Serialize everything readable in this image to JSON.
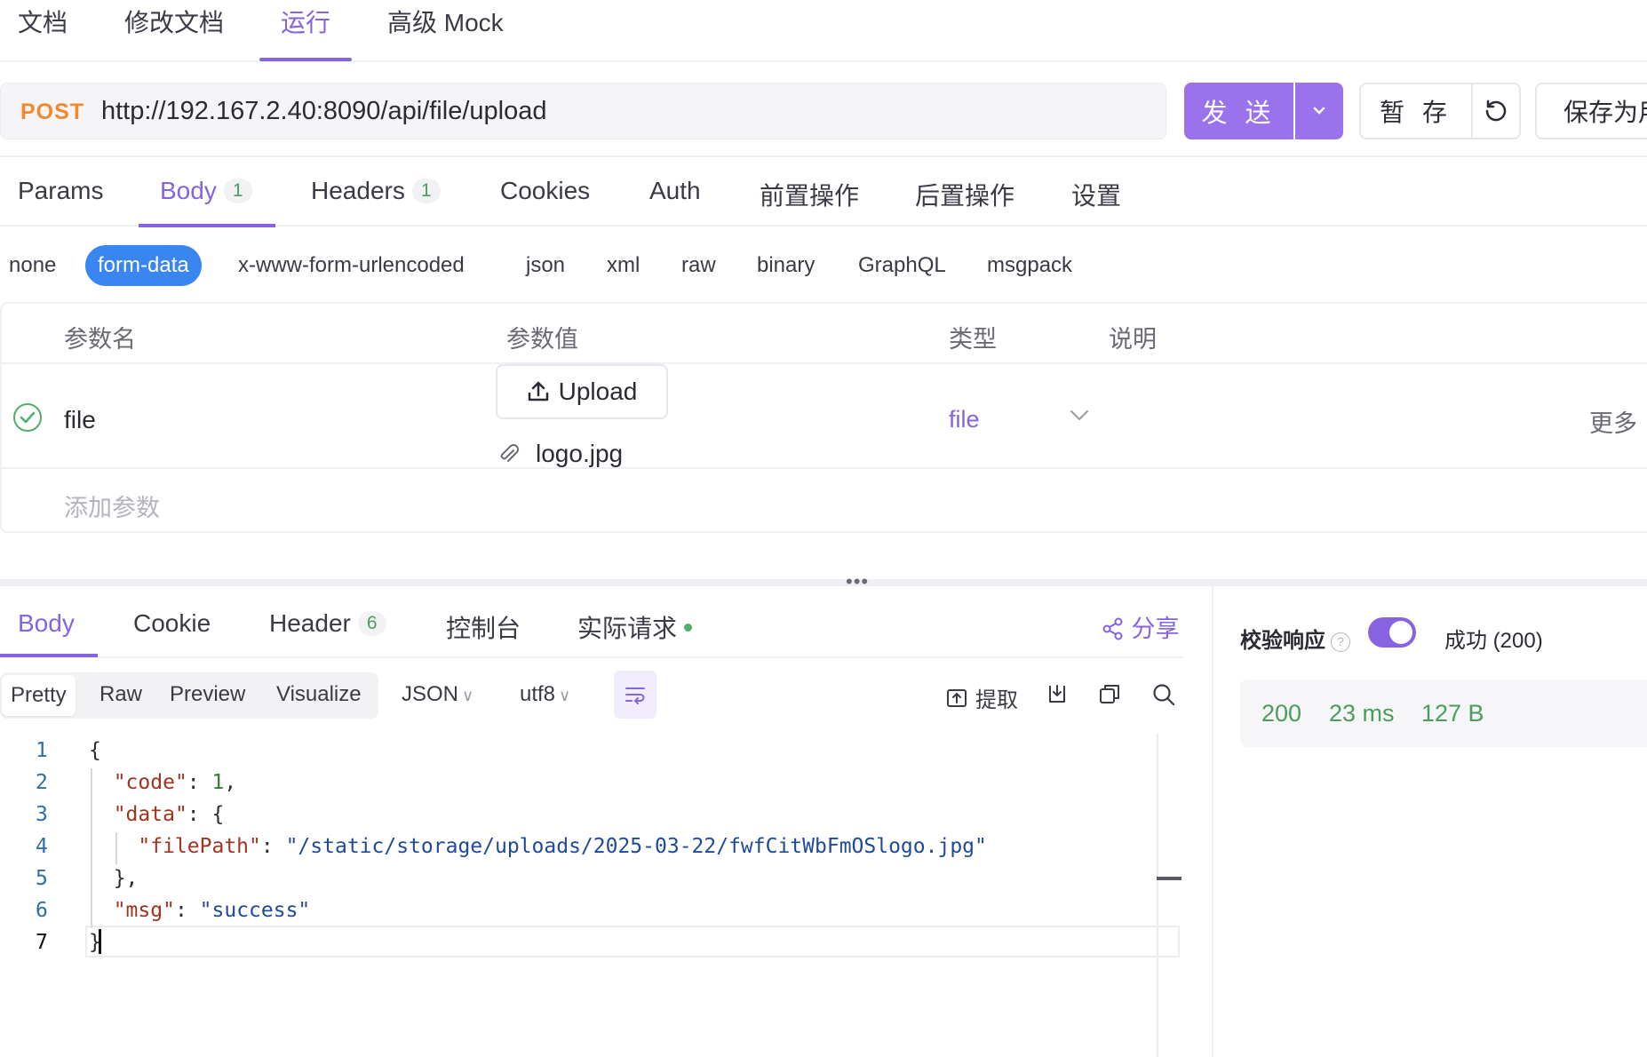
{
  "top_tabs": [
    "文档",
    "修改文档",
    "运行",
    "高级 Mock"
  ],
  "request": {
    "method": "POST",
    "url": "http://192.167.2.40:8090/api/file/upload",
    "send_label": "发 送",
    "save_temp_label": "暂 存",
    "save_as_label": "保存为用"
  },
  "req_tabs": {
    "params": "Params",
    "body": "Body",
    "body_count": "1",
    "headers": "Headers",
    "headers_count": "1",
    "cookies": "Cookies",
    "auth": "Auth",
    "pre": "前置操作",
    "post": "后置操作",
    "settings": "设置"
  },
  "body_types": [
    "none",
    "form-data",
    "x-www-form-urlencoded",
    "json",
    "xml",
    "raw",
    "binary",
    "GraphQL",
    "msgpack"
  ],
  "params_table": {
    "headers": [
      "参数名",
      "参数值",
      "类型",
      "说明"
    ],
    "row": {
      "name": "file",
      "upload_label": "Upload",
      "filename": "logo.jpg",
      "type": "file",
      "more": "更多"
    },
    "add_placeholder": "添加参数"
  },
  "response_tabs": {
    "body": "Body",
    "cookie": "Cookie",
    "header": "Header",
    "header_count": "6",
    "console": "控制台",
    "actual": "实际请求",
    "share": "分享"
  },
  "view_options": [
    "Pretty",
    "Raw",
    "Preview",
    "Visualize"
  ],
  "format": "JSON",
  "encoding": "utf8",
  "extract_label": "提取",
  "code_line_numbers": [
    "1",
    "2",
    "3",
    "4",
    "5",
    "6",
    "7"
  ],
  "response_json": {
    "code_key": "\"code\"",
    "code_val": "1",
    "data_key": "\"data\"",
    "filepath_key": "\"filePath\"",
    "filepath_val": "\"/static/storage/uploads/2025-03-22/fwfCitWbFmOSlogo.jpg\"",
    "msg_key": "\"msg\"",
    "msg_val": "\"success\""
  },
  "validation": {
    "label": "校验响应",
    "enabled": true,
    "status": "成功 (200)"
  },
  "stats": {
    "code": "200",
    "time": "23 ms",
    "size": "127 B"
  },
  "colors": {
    "accent": "#8663e0",
    "send_bg": "#9a73ec",
    "method": "#f08a2c",
    "active_body_type": "#3a86f0",
    "success": "#4a9e5c"
  }
}
